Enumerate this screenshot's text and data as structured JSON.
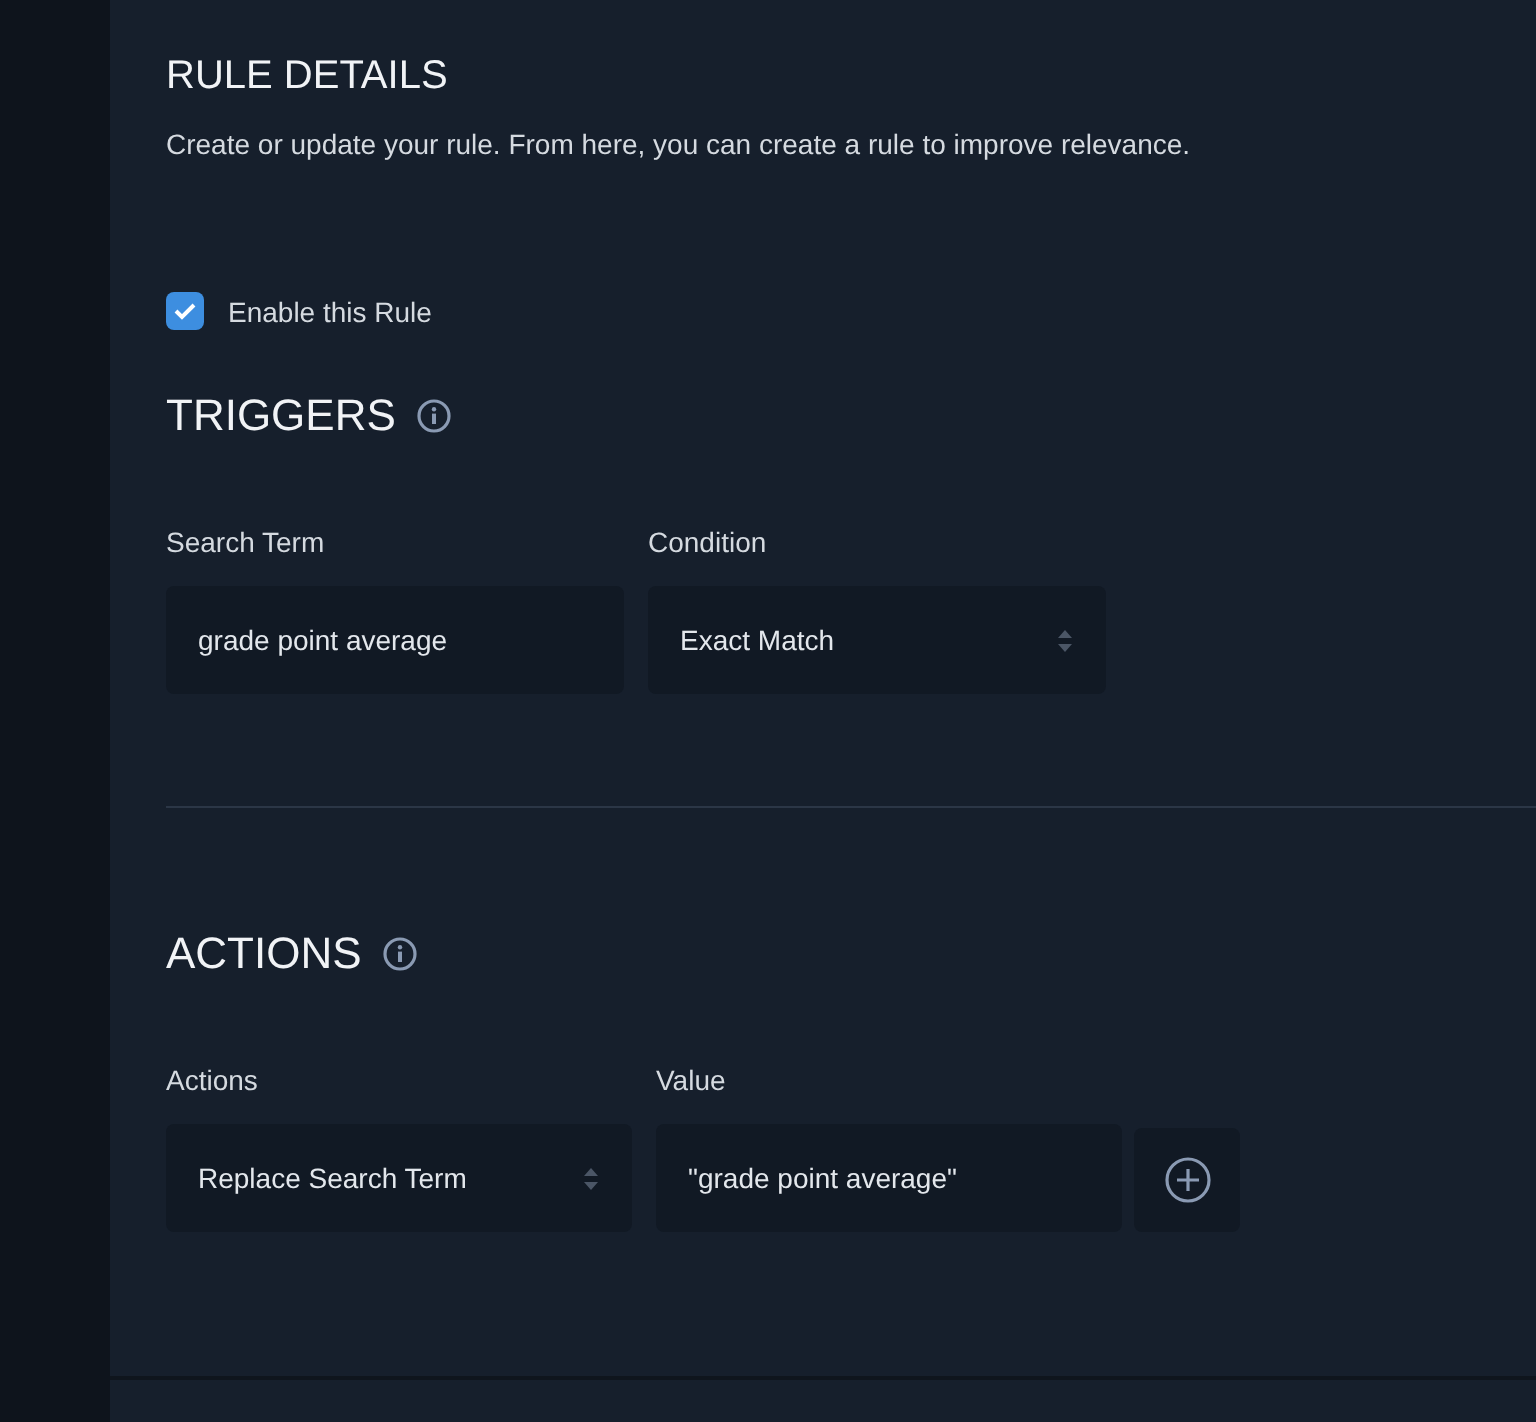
{
  "header": {
    "title": "RULE DETAILS",
    "description": "Create or update your rule. From here, you can create a rule to improve relevance."
  },
  "enable_rule": {
    "label": "Enable this Rule",
    "checked": true
  },
  "triggers": {
    "title": "TRIGGERS",
    "fields": [
      {
        "kind": "input",
        "label": "Search Term",
        "value": "grade point average"
      },
      {
        "kind": "select",
        "label": "Condition",
        "value": "Exact Match"
      }
    ]
  },
  "actions": {
    "title": "ACTIONS",
    "fields": [
      {
        "kind": "select",
        "label": "Actions",
        "value": "Replace Search Term"
      },
      {
        "kind": "input",
        "label": "Value",
        "value": "\"grade point average\""
      }
    ]
  }
}
